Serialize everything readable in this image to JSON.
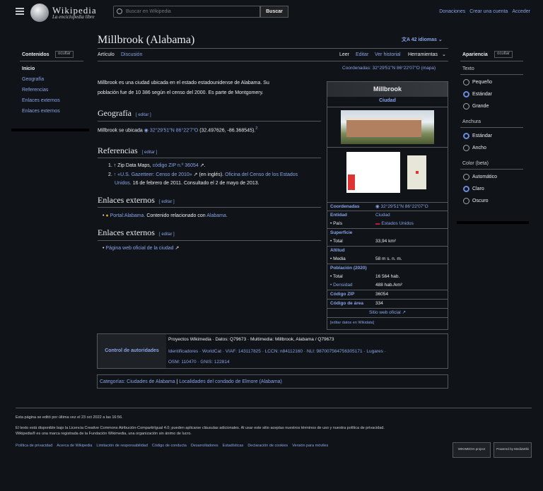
{
  "header": {
    "logo_word": "Wikipedia",
    "logo_tag": "La enciclopedia libre",
    "search_placeholder": "Buscar en Wikipedia",
    "search_button": "Buscar",
    "links": [
      "Donaciones",
      "Crear una cuenta",
      "Acceder"
    ]
  },
  "page": {
    "title": "Millbrook (Alabama)",
    "languages": "42 idiomas",
    "tabs_left": [
      "Artículo",
      "Discusión"
    ],
    "tabs_right": [
      "Leer",
      "Editar",
      "Ver historial",
      "Herramientas"
    ],
    "coords_top": "Coordenadas: 32°29′51″N 86°22′07″O (mapa)"
  },
  "toc": {
    "title": "Contenidos",
    "hide": "ocultar",
    "items": [
      "Inicio",
      "Geografía",
      "Referencias",
      "Enlaces externos",
      "Enlaces externos"
    ]
  },
  "appearance": {
    "title": "Apariencia",
    "hide": "ocultar",
    "text_h": "Texto",
    "text_opts": [
      "Pequeño",
      "Estándar",
      "Grande"
    ],
    "width_h": "Anchura",
    "width_opts": [
      "Estándar",
      "Ancho"
    ],
    "color_h": "Color (beta)",
    "color_opts": [
      "Automático",
      "Claro",
      "Oscuro"
    ]
  },
  "body": {
    "intro_1": "Millbrook es una ciudad ubicada en el estado estadounidense de Alabama. Su",
    "intro_2": "población fue de 10 386 según el censo del 2000. Es parte de Montgomery.",
    "h_geo": "Geografía",
    "edit": "editar",
    "geo_text": "Millbrook se ubicada",
    "geo_coords": "32°29′51″N 86°22′7″O",
    "geo_rest": "(32.497626, -86.368545).",
    "geo_sup": "2",
    "h_ref": "Referencias",
    "ref1_num": "1.",
    "ref1_a": "↑ Zip Data Maps,",
    "ref1_b": "código ZIP n.º 36054",
    "ref2_num": "2.",
    "ref2_a": "↑ «U.S. Gazetteer: Censo de 2010»",
    "ref2_b": "(en inglés).",
    "ref2_c": "Oficina del Censo de los Estados",
    "ref2_d": "Unidos.",
    "ref2_e": "16 de febrero de 2011. Consultado el 2 de mayo de 2013.",
    "h_ext1": "Enlaces externos",
    "ext1_a": "Portal:Alabama.",
    "ext1_b": "Contenido relacionado con",
    "ext1_c": "Alabama.",
    "h_ext2": "Enlaces externos",
    "ext2_a": "Página web oficial de la ciudad"
  },
  "infobox": {
    "title": "Millbrook",
    "subtitle": "Ciudad",
    "rows": [
      {
        "label": "Coordenadas",
        "value": "32°29′51″N 86°22′07″O"
      },
      {
        "label": "Entidad",
        "value": "Ciudad"
      },
      {
        "label": "• País",
        "value": "Estados Unidos"
      },
      {
        "label": "Superficie",
        "value": ""
      },
      {
        "label": "• Total",
        "value": "33,94 km²"
      },
      {
        "label": "Altitud",
        "value": ""
      },
      {
        "label": "• Media",
        "value": "58 m s. n. m."
      },
      {
        "label": "Población (2020)",
        "value": ""
      },
      {
        "label": "• Total",
        "value": "16 564 hab."
      },
      {
        "label": "• Densidad",
        "value": "488 hab./km²"
      },
      {
        "label": "Código ZIP",
        "value": "36054"
      },
      {
        "label": "Código de área",
        "value": "334"
      }
    ],
    "website": "Sitio web oficial",
    "edit": "[editar datos en Wikidata]"
  },
  "authority": {
    "label": "Control de autoridades",
    "row1": "Proyectos Wikimedia · Datos: Q79673 · Multimedia: Millbrook, Alabama / Q79673",
    "row2": "Identificadores · WorldCat · VIAF: 143117825 · LCCN: n84112160 · NLI: 987007564756305171 · Lugares ·",
    "row3": "OSM: 110470 · GNIS: 122814"
  },
  "categories": {
    "label": "Categorías:",
    "items": [
      "Ciudades de Alabama",
      "Localidades del condado de Elmore (Alabama)"
    ]
  },
  "footer": {
    "edited": "Esta página se editó por última vez el 23 oct 2022 a las 16:56.",
    "license_1": "El texto está disponible bajo la Licencia Creative Commons Atribución-CompartirIgual 4.0; pueden aplicarse cláusulas adicionales. Al usar este sitio aceptas nuestros términos de uso y nuestra política de privacidad.",
    "license_2": "Wikipedia® es una marca registrada de la Fundación Wikimedia, una organización sin ánimo de lucro.",
    "links": [
      "Política de privacidad",
      "Acerca de Wikipedia",
      "Limitación de responsabilidad",
      "Código de conducta",
      "Desarrolladores",
      "Estadísticas",
      "Declaración de cookies",
      "Versión para móviles"
    ],
    "badge1": "WIKIMEDIA project",
    "badge2": "Powered by MediaWiki"
  }
}
